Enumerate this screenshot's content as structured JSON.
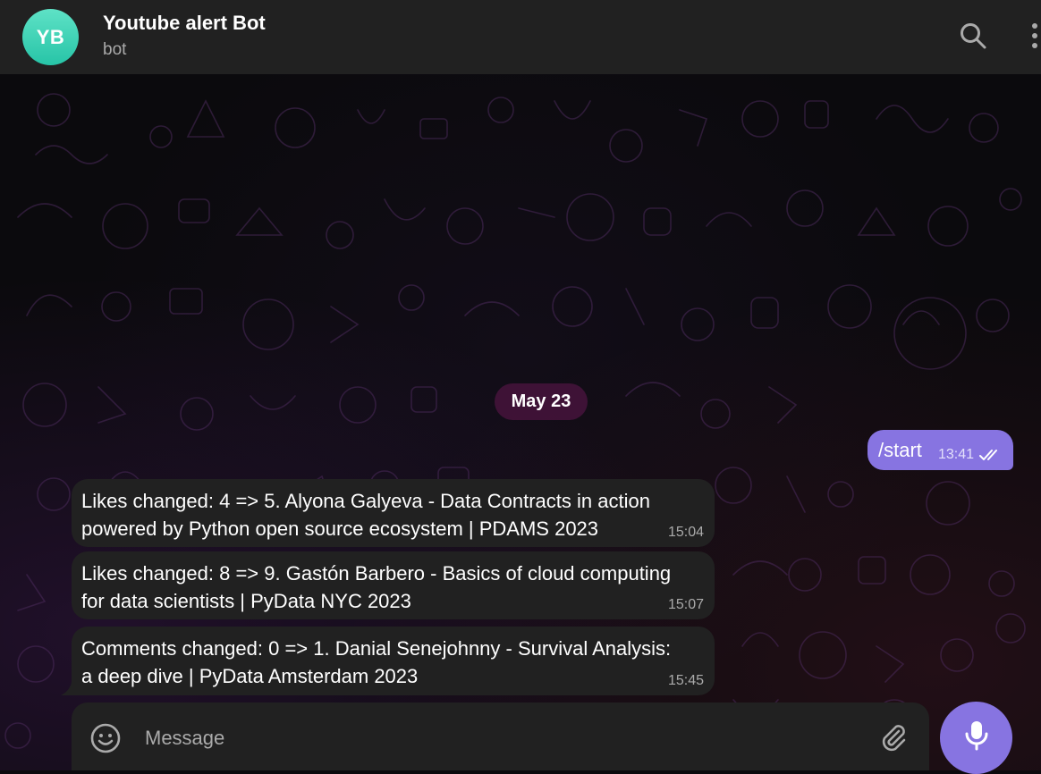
{
  "header": {
    "avatar_initials": "YB",
    "title": "Youtube alert Bot",
    "subtitle": "bot",
    "icons": [
      "search-icon",
      "more-vertical-icon"
    ]
  },
  "chat": {
    "date_separator": "May 23",
    "outgoing": {
      "text": "/start",
      "time": "13:41",
      "status": "read-double-check"
    },
    "messages": [
      {
        "text": "Likes changed: 4 => 5. Alyona Galyeva - Data Contracts in action powered by Python open source ecosystem | PDAMS 2023",
        "time": "15:04"
      },
      {
        "text": "Likes changed: 8 => 9. Gastón Barbero - Basics of cloud computing for data scientists | PyData NYC 2023",
        "time": "15:07"
      },
      {
        "text": "Comments changed: 0 => 1. Danial Senejohnny - Survival Analysis: a deep dive | PyData Amsterdam 2023",
        "time": "15:45"
      }
    ]
  },
  "composer": {
    "placeholder": "Message",
    "icons": [
      "emoji-icon",
      "attach-icon",
      "microphone-icon"
    ]
  },
  "colors": {
    "accent": "#8774e1",
    "avatar": "#2fcbad",
    "bubble_in": "#212121",
    "header": "#212121"
  }
}
